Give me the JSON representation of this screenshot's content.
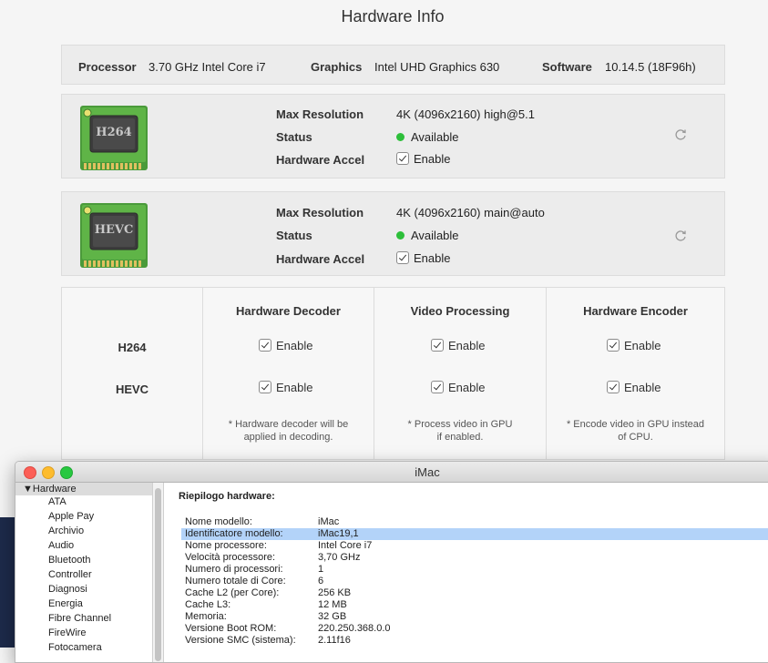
{
  "window": {
    "title": "Hardware Info"
  },
  "info_bar": {
    "processor_label": "Processor",
    "processor_value": "3.70 GHz Intel Core i7",
    "graphics_label": "Graphics",
    "graphics_value": "Intel UHD Graphics 630",
    "software_label": "Software",
    "software_value": "10.14.5 (18F96h)"
  },
  "codecs": [
    {
      "chip_label": "H264",
      "max_res_label": "Max Resolution",
      "max_res_value": "4K (4096x2160) high@5.1",
      "status_label": "Status",
      "status_value": "Available",
      "hw_accel_label": "Hardware Accel",
      "hw_accel_value": "Enable"
    },
    {
      "chip_label": "HEVC",
      "max_res_label": "Max Resolution",
      "max_res_value": "4K (4096x2160) main@auto",
      "status_label": "Status",
      "status_value": "Available",
      "hw_accel_label": "Hardware Accel",
      "hw_accel_value": "Enable"
    }
  ],
  "colors": {
    "status_available": "#2dbf3a",
    "chip_green": "#4a9a3a",
    "selection": "#b3d3f9"
  },
  "matrix": {
    "columns": [
      "Hardware Decoder",
      "Video Processing",
      "Hardware Encoder"
    ],
    "rows": [
      "H264",
      "HEVC"
    ],
    "checkbox_label": "Enable",
    "notes": [
      "* Hardware decoder will be\napplied in decoding.",
      "* Process video in GPU\nif enabled.",
      "* Encode video in GPU instead\nof CPU."
    ]
  },
  "sysinfo": {
    "title": "iMac",
    "sidebar_header": "Hardware",
    "sidebar_items": [
      "ATA",
      "Apple Pay",
      "Archivio",
      "Audio",
      "Bluetooth",
      "Controller",
      "Diagnosi",
      "Energia",
      "Fibre Channel",
      "FireWire",
      "Fotocamera"
    ],
    "summary_heading": "Riepilogo hardware:",
    "rows": [
      {
        "k": "Nome modello:",
        "v": "iMac"
      },
      {
        "k": "Identificatore modello:",
        "v": "iMac19,1"
      },
      {
        "k": "Nome processore:",
        "v": "Intel Core i7"
      },
      {
        "k": "Velocità processore:",
        "v": "3,70 GHz"
      },
      {
        "k": "Numero di processori:",
        "v": "1"
      },
      {
        "k": "Numero totale di Core:",
        "v": "6"
      },
      {
        "k": "Cache L2 (per Core):",
        "v": "256 KB"
      },
      {
        "k": "Cache L3:",
        "v": "12 MB"
      },
      {
        "k": "Memoria:",
        "v": "32 GB"
      },
      {
        "k": "Versione Boot ROM:",
        "v": "220.250.368.0.0"
      },
      {
        "k": "Versione SMC (sistema):",
        "v": "2.11f16"
      }
    ]
  }
}
